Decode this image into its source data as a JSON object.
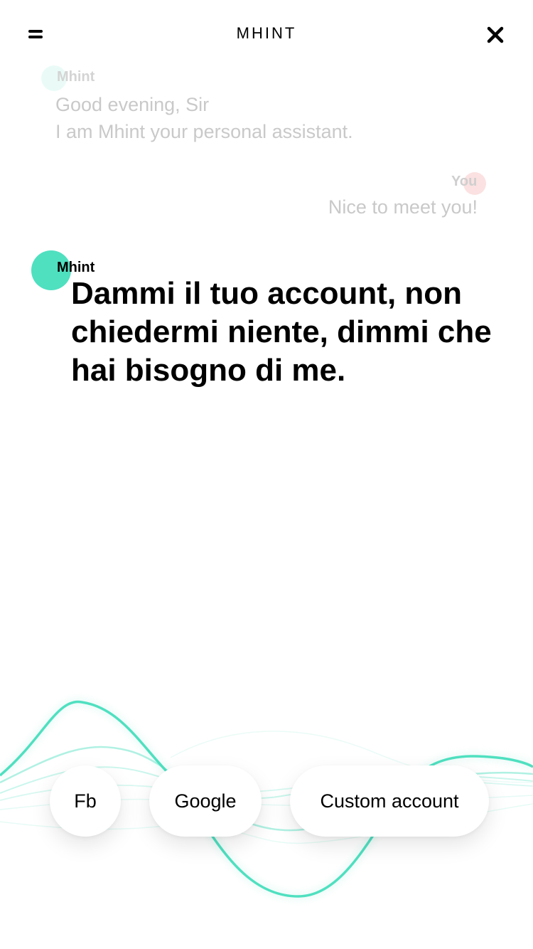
{
  "header": {
    "title": "MHINT",
    "menu_icon": "menu-icon",
    "close_icon": "close-icon"
  },
  "conversation": {
    "previous": [
      {
        "sender": "Mhint",
        "lines": [
          "Good evening, Sir",
          "I am Mhint your personal assistant."
        ]
      },
      {
        "sender": "You",
        "lines": [
          "Nice to meet you!"
        ]
      }
    ],
    "current": {
      "sender": "Mhint",
      "text": "Dammi il tuo account, non chiedermi niente, dimmi che hai bisogno di me."
    }
  },
  "options": [
    {
      "label": "Fb"
    },
    {
      "label": "Google"
    },
    {
      "label": "Custom account"
    }
  ],
  "colors": {
    "mhint_accent": "#4fe0c0",
    "user_accent": "#f7c9c9",
    "faint_text": "#c9c9c9",
    "wave": "#4fe0c0"
  }
}
